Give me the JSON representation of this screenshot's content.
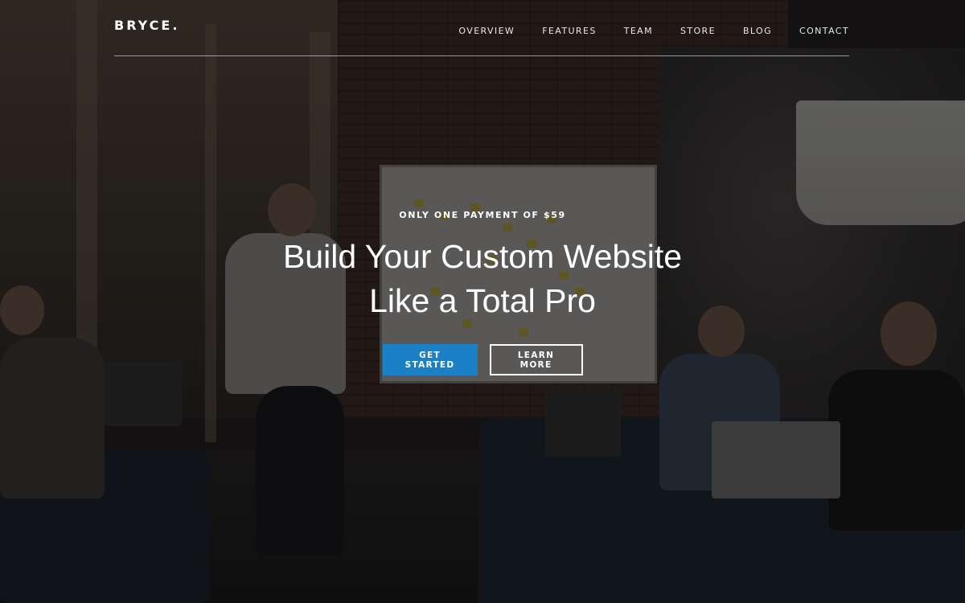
{
  "header": {
    "brand": "BRYCE.",
    "nav": [
      {
        "label": "OVERVIEW"
      },
      {
        "label": "FEATURES"
      },
      {
        "label": "TEAM"
      },
      {
        "label": "STORE"
      },
      {
        "label": "BLOG"
      },
      {
        "label": "CONTACT"
      }
    ]
  },
  "hero": {
    "eyebrow": "ONLY ONE PAYMENT OF $59",
    "headline_line1": "Build Your Custom Website",
    "headline_line2": "Like a Total Pro",
    "primary_cta": "GET STARTED",
    "secondary_cta": "LEARN MORE"
  },
  "colors": {
    "accent": "#1b80c5",
    "text": "#ffffff",
    "overlay": "#0a0a0c"
  }
}
